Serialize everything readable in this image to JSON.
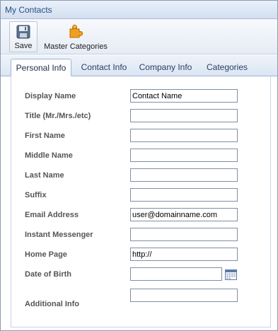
{
  "window": {
    "title": "My Contacts"
  },
  "toolbar": {
    "save_label": "Save",
    "master_label": "Master Categories",
    "save_icon": "floppy-disk-icon",
    "master_icon": "puzzle-piece-icon"
  },
  "tabs": [
    {
      "label": "Personal Info",
      "active": true
    },
    {
      "label": "Contact Info",
      "active": false
    },
    {
      "label": "Company Info",
      "active": false
    },
    {
      "label": "Categories",
      "active": false
    }
  ],
  "form": {
    "display_name": {
      "label": "Display Name",
      "value": "Contact Name"
    },
    "title": {
      "label": "Title (Mr./Mrs./etc)",
      "value": ""
    },
    "first_name": {
      "label": "First Name",
      "value": ""
    },
    "middle_name": {
      "label": "Middle Name",
      "value": ""
    },
    "last_name": {
      "label": "Last Name",
      "value": ""
    },
    "suffix": {
      "label": "Suffix",
      "value": ""
    },
    "email": {
      "label": "Email Address",
      "value": "user@domainname.com"
    },
    "im": {
      "label": "Instant Messenger",
      "value": ""
    },
    "home_page": {
      "label": "Home Page",
      "value": "http://"
    },
    "dob": {
      "label": "Date of Birth",
      "value": ""
    },
    "additional_info": {
      "label": "Additional Info",
      "value": ""
    }
  },
  "colors": {
    "accent": "#2a4d80",
    "border": "#9fb4d2"
  }
}
